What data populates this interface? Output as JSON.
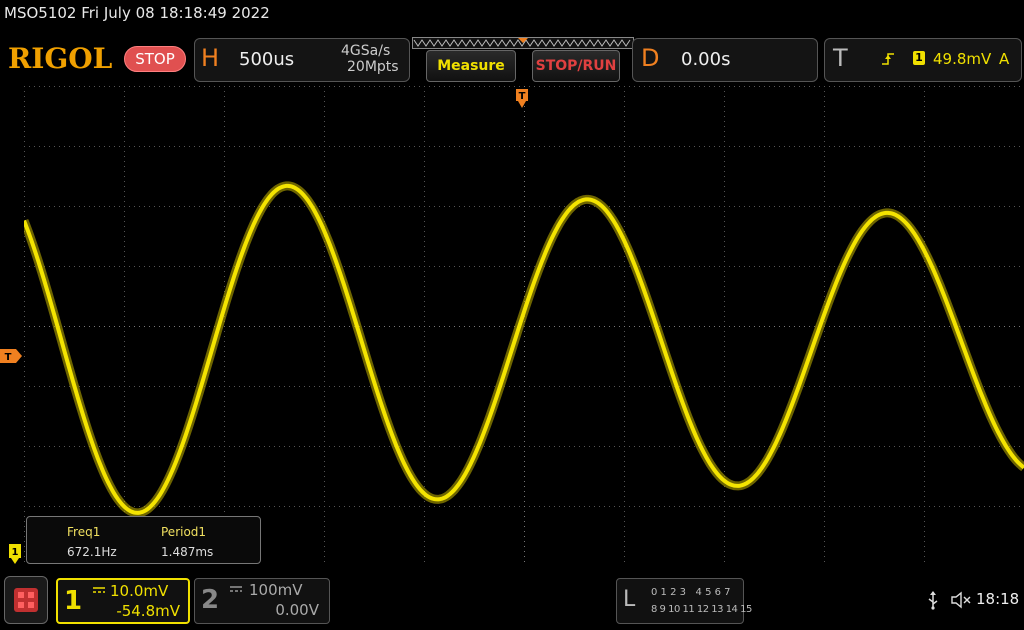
{
  "header": {
    "device_line": "MSO5102  Fri July 08 18:18:49 2022",
    "logo": "RIGOL",
    "run_state": "STOP"
  },
  "horizontal": {
    "letter": "H",
    "timebase": "500us",
    "sample_rate": "4GSa/s",
    "memory_depth": "20Mpts"
  },
  "buttons": {
    "measure": "Measure",
    "stop_run": "STOP/RUN"
  },
  "delay": {
    "letter": "D",
    "value": "0.00s"
  },
  "trigger": {
    "letter": "T",
    "source": "1",
    "level": "49.8mV",
    "mode": "A"
  },
  "markers": {
    "trigger_marker": "T",
    "channel1_marker": "1"
  },
  "measurements": {
    "freq_label": "Freq1",
    "freq_value": "672.1Hz",
    "period_label": "Period1",
    "period_value": "1.487ms"
  },
  "channel1": {
    "number": "1",
    "scale": "10.0mV",
    "offset": "-54.8mV"
  },
  "channel2": {
    "number": "2",
    "scale": "100mV",
    "offset": "0.00V"
  },
  "logic": {
    "letter": "L",
    "row1": "0 1 2 3   4 5 6 7",
    "row2": "8 9 10 11 12 13 14 15"
  },
  "status": {
    "time": "18:18"
  },
  "colors": {
    "trace": "#f0e000",
    "accent": "#f08020",
    "stop": "#e05050"
  }
}
